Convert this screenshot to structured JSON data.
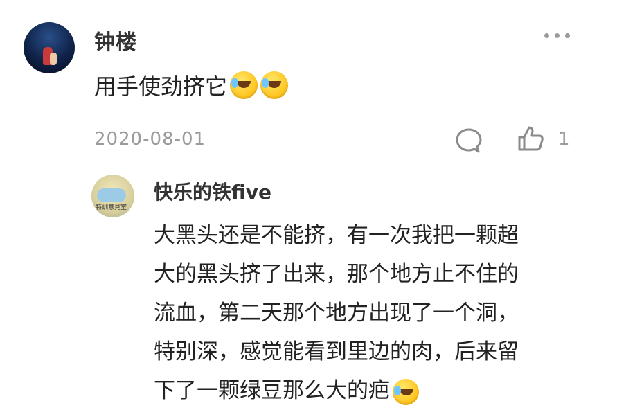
{
  "comment": {
    "username": "钟楼",
    "text": "用手使劲挤它",
    "emojis": [
      "laughing-crying-emoji",
      "laughing-crying-emoji"
    ],
    "date": "2020-08-01",
    "like_count": "1",
    "more_icon": "more-dots-icon",
    "reply_icon": "comment-bubble-icon",
    "like_icon": "thumbs-up-icon"
  },
  "reply": {
    "username": "快乐的铁five",
    "avatar_text": "特訓意見室",
    "lines": [
      "大黑头还是不能挤，有一次我把一颗超",
      "大的黑头挤了出来，那个地方止不住的",
      "流血，第二天那个地方出现了一个洞，",
      "特别深，感觉能看到里边的肉，后来留",
      "下了一颗绿豆那么大的疤"
    ],
    "trailing_emoji": "laughing-crying-emoji"
  },
  "colors": {
    "primary_text": "#222222",
    "username_text": "#333333",
    "meta_text": "#9b9b9b",
    "emoji": "#ffc21a"
  }
}
